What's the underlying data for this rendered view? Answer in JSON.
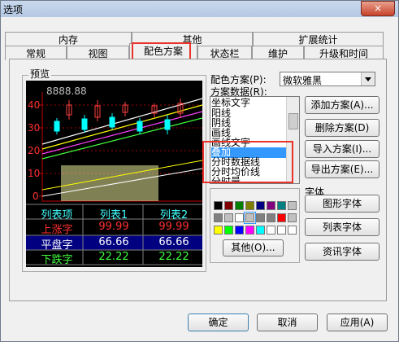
{
  "window": {
    "title": "选项",
    "close_glyph": "×"
  },
  "tabs_back": [
    "内存",
    "其他",
    "扩展统计"
  ],
  "tabs_front": [
    "常规",
    "视图",
    "配色方案",
    "状态栏",
    "维护",
    "升级和时间"
  ],
  "preview": {
    "caption": "预览",
    "price_label": "8888.88",
    "y_ticks": [
      "40",
      "30",
      "20",
      "10",
      "0"
    ],
    "table": {
      "header": [
        "列表项",
        "列表1",
        "列表2"
      ],
      "rows": [
        {
          "name": "上涨字",
          "v1": "99.99",
          "v2": "99.99"
        },
        {
          "name": "平盘字",
          "v1": "66.66",
          "v2": "66.66"
        },
        {
          "name": "下跌字",
          "v1": "22.22",
          "v2": "22.22"
        }
      ]
    }
  },
  "scheme": {
    "label": "配色方案(P):",
    "value": "微软雅黑"
  },
  "data_label": "方案数据(R):",
  "data_items": [
    "坐标文字",
    "阳线",
    "阴线",
    "画线",
    "画线文字",
    "叠加",
    "分时数据线",
    "分时均价线",
    "分时量"
  ],
  "selected_item": "叠加",
  "buttons": {
    "add": "添加方案(A)...",
    "delete": "删除方案(D)",
    "import": "导入方案(I)...",
    "export": "导出方案(E)...",
    "other": "其他(O)...",
    "graph_font": "图形字体",
    "list_font": "列表字体",
    "info_font": "资讯字体",
    "ok": "确定",
    "cancel": "取消",
    "apply": "应用(A)"
  },
  "font_group": {
    "caption": "字体"
  },
  "palette": {
    "row1": [
      "#000000",
      "#800000",
      "#008000",
      "#808000",
      "#000080",
      "#800080",
      "#008080",
      "#c0c0c0"
    ],
    "row2": [
      "#808080",
      "#c0c0c0",
      "#ffffff",
      "#c0c0c0",
      "#808080",
      "#808080",
      "#ff0000",
      "#c0c0c0"
    ],
    "row3": [
      "#ffff00",
      "#00ff00",
      "#0000ff",
      "#ff00ff",
      "#00ffff",
      "#ffffff",
      "#ffffff",
      "#ffffff"
    ]
  }
}
